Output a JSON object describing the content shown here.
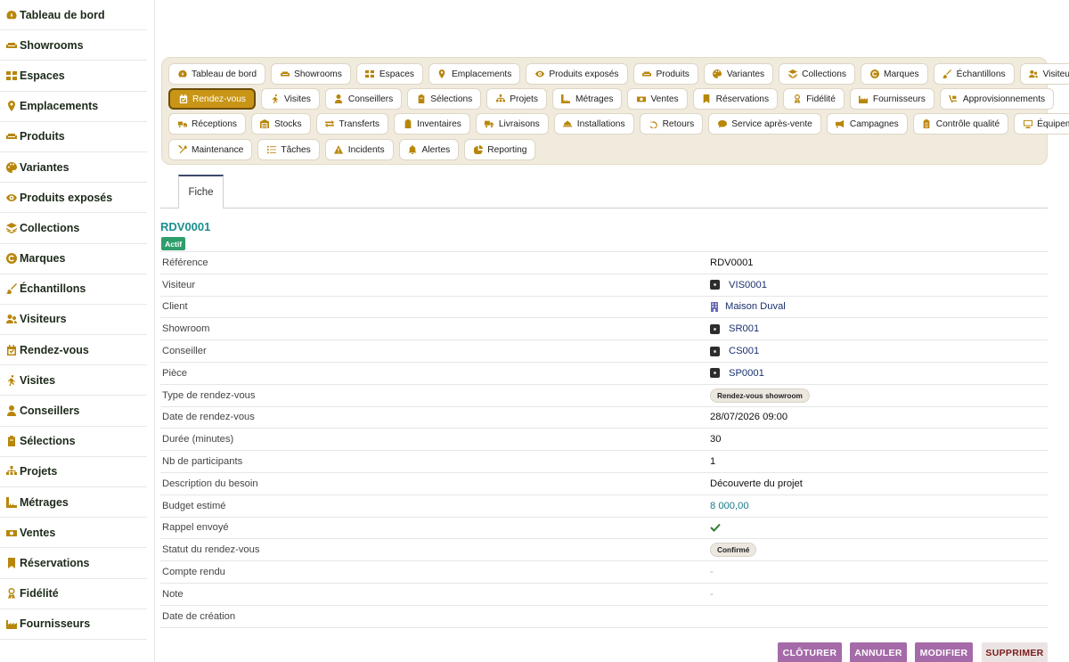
{
  "sidebar": {
    "items": [
      {
        "label": "Tableau de bord",
        "icon": "dashboard-icon"
      },
      {
        "label": "Showrooms",
        "icon": "sofa-icon"
      },
      {
        "label": "Espaces",
        "icon": "grid-icon"
      },
      {
        "label": "Emplacements",
        "icon": "map-pin-icon"
      },
      {
        "label": "Produits",
        "icon": "sofa-icon"
      },
      {
        "label": "Variantes",
        "icon": "palette-icon"
      },
      {
        "label": "Produits exposés",
        "icon": "eye-icon"
      },
      {
        "label": "Collections",
        "icon": "layers-icon"
      },
      {
        "label": "Marques",
        "icon": "copyright-icon"
      },
      {
        "label": "Échantillons",
        "icon": "brush-icon"
      },
      {
        "label": "Visiteurs",
        "icon": "users-icon"
      },
      {
        "label": "Rendez-vous",
        "icon": "calendar-check-icon"
      },
      {
        "label": "Visites",
        "icon": "walking-icon"
      },
      {
        "label": "Conseillers",
        "icon": "user-tie-icon"
      },
      {
        "label": "Sélections",
        "icon": "clipboard-icon"
      },
      {
        "label": "Projets",
        "icon": "sitemap-icon"
      },
      {
        "label": "Métrages",
        "icon": "ruler-icon"
      },
      {
        "label": "Ventes",
        "icon": "cash-icon"
      },
      {
        "label": "Réservations",
        "icon": "bookmark-icon"
      },
      {
        "label": "Fidélité",
        "icon": "award-icon"
      },
      {
        "label": "Fournisseurs",
        "icon": "industry-icon"
      }
    ]
  },
  "nav": {
    "rows": [
      [
        {
          "label": "Tableau de bord",
          "icon": "dashboard-icon"
        },
        {
          "label": "Showrooms",
          "icon": "sofa-icon"
        },
        {
          "label": "Espaces",
          "icon": "grid-icon"
        },
        {
          "label": "Emplacements",
          "icon": "map-pin-icon"
        },
        {
          "label": "Produits exposés",
          "icon": "eye-icon"
        },
        {
          "label": "Produits",
          "icon": "sofa-icon"
        },
        {
          "label": "Variantes",
          "icon": "palette-icon"
        },
        {
          "label": "Collections",
          "icon": "layers-icon"
        },
        {
          "label": "Marques",
          "icon": "copyright-icon"
        },
        {
          "label": "Échantillons",
          "icon": "brush-icon"
        },
        {
          "label": "Visiteurs",
          "icon": "users-icon"
        }
      ],
      [
        {
          "label": "Rendez-vous",
          "icon": "calendar-check-icon",
          "active": true
        },
        {
          "label": "Visites",
          "icon": "walking-icon"
        },
        {
          "label": "Conseillers",
          "icon": "user-tie-icon"
        },
        {
          "label": "Sélections",
          "icon": "clipboard-icon"
        },
        {
          "label": "Projets",
          "icon": "sitemap-icon"
        },
        {
          "label": "Métrages",
          "icon": "ruler-icon"
        },
        {
          "label": "Ventes",
          "icon": "cash-icon"
        },
        {
          "label": "Réservations",
          "icon": "bookmark-icon"
        },
        {
          "label": "Fidélité",
          "icon": "award-icon"
        },
        {
          "label": "Fournisseurs",
          "icon": "industry-icon"
        },
        {
          "label": "Approvisionnements",
          "icon": "dolly-icon"
        }
      ],
      [
        {
          "label": "Réceptions",
          "icon": "truck-loading-icon"
        },
        {
          "label": "Stocks",
          "icon": "warehouse-icon"
        },
        {
          "label": "Transferts",
          "icon": "exchange-icon"
        },
        {
          "label": "Inventaires",
          "icon": "clipboard-check-icon"
        },
        {
          "label": "Livraisons",
          "icon": "truck-icon"
        },
        {
          "label": "Installations",
          "icon": "hard-hat-icon"
        },
        {
          "label": "Retours",
          "icon": "undo-icon"
        },
        {
          "label": "Service après-vente",
          "icon": "comment-icon"
        },
        {
          "label": "Campagnes",
          "icon": "bullhorn-icon"
        },
        {
          "label": "Contrôle qualité",
          "icon": "clipboard-list-icon"
        },
        {
          "label": "Équipements",
          "icon": "desktop-icon"
        }
      ],
      [
        {
          "label": "Maintenance",
          "icon": "tools-icon"
        },
        {
          "label": "Tâches",
          "icon": "list-icon"
        },
        {
          "label": "Incidents",
          "icon": "warning-icon"
        },
        {
          "label": "Alertes",
          "icon": "bell-icon"
        },
        {
          "label": "Reporting",
          "icon": "pie-chart-icon"
        }
      ]
    ]
  },
  "tabs": {
    "fiche": "Fiche"
  },
  "record": {
    "id": "RDV0001",
    "status": "Actif",
    "fields": [
      {
        "label": "Référence",
        "value": "RDV0001",
        "type": "text"
      },
      {
        "label": "Visiteur",
        "value": "VIS0001",
        "type": "link"
      },
      {
        "label": "Client",
        "value": "Maison Duval",
        "type": "building-link"
      },
      {
        "label": "Showroom",
        "value": "SR001",
        "type": "link"
      },
      {
        "label": "Conseiller",
        "value": "CS001",
        "type": "link"
      },
      {
        "label": "Pièce",
        "value": "SP0001",
        "type": "link"
      },
      {
        "label": "Type de rendez-vous",
        "value": "Rendez-vous showroom",
        "type": "pill"
      },
      {
        "label": "Date de rendez-vous",
        "value": "28/07/2026 09:00",
        "type": "text"
      },
      {
        "label": "Durée (minutes)",
        "value": "30",
        "type": "text"
      },
      {
        "label": "Nb de participants",
        "value": "1",
        "type": "text"
      },
      {
        "label": "Description du besoin",
        "value": "Découverte du projet",
        "type": "text"
      },
      {
        "label": "Budget estimé",
        "value": "8 000,00",
        "type": "teal"
      },
      {
        "label": "Rappel envoyé",
        "value": "",
        "type": "check"
      },
      {
        "label": "Statut du rendez-vous",
        "value": "Confirmé",
        "type": "pill"
      },
      {
        "label": "Compte rendu",
        "value": "-",
        "type": "muted"
      },
      {
        "label": "Note",
        "value": "-",
        "type": "muted"
      },
      {
        "label": "Date de création",
        "value": "",
        "type": "text"
      }
    ]
  },
  "actions": {
    "close": "CLÔTURER",
    "cancel": "ANNULER",
    "edit": "MODIFIER",
    "delete": "SUPPRIMER"
  },
  "colors": {
    "accent": "#c99516",
    "icon": "#b8860b",
    "link": "#1b3170",
    "teal": "#1a8f8f",
    "badge": "#2e9e6b",
    "action": "#a56aa8"
  }
}
